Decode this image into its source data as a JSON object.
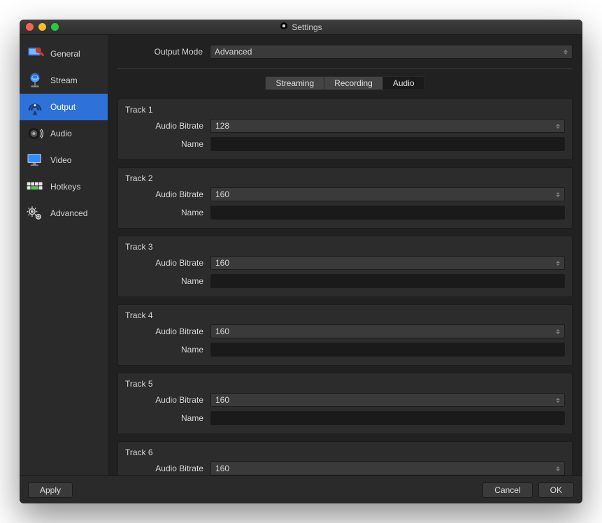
{
  "window": {
    "title": "Settings"
  },
  "sidebar": {
    "items": [
      {
        "key": "general",
        "label": "General"
      },
      {
        "key": "stream",
        "label": "Stream"
      },
      {
        "key": "output",
        "label": "Output",
        "active": true
      },
      {
        "key": "audio",
        "label": "Audio"
      },
      {
        "key": "video",
        "label": "Video"
      },
      {
        "key": "hotkeys",
        "label": "Hotkeys"
      },
      {
        "key": "advanced",
        "label": "Advanced"
      }
    ]
  },
  "main": {
    "output_mode_label": "Output Mode",
    "output_mode_value": "Advanced",
    "tabs": [
      {
        "key": "streaming",
        "label": "Streaming"
      },
      {
        "key": "recording",
        "label": "Recording"
      },
      {
        "key": "audio",
        "label": "Audio",
        "active": true
      }
    ],
    "field_labels": {
      "bitrate": "Audio Bitrate",
      "name": "Name"
    },
    "tracks": [
      {
        "title": "Track 1",
        "bitrate": "128",
        "name": ""
      },
      {
        "title": "Track 2",
        "bitrate": "160",
        "name": ""
      },
      {
        "title": "Track 3",
        "bitrate": "160",
        "name": ""
      },
      {
        "title": "Track 4",
        "bitrate": "160",
        "name": ""
      },
      {
        "title": "Track 5",
        "bitrate": "160",
        "name": ""
      },
      {
        "title": "Track 6",
        "bitrate": "160",
        "name": ""
      }
    ]
  },
  "footer": {
    "apply": "Apply",
    "cancel": "Cancel",
    "ok": "OK"
  }
}
